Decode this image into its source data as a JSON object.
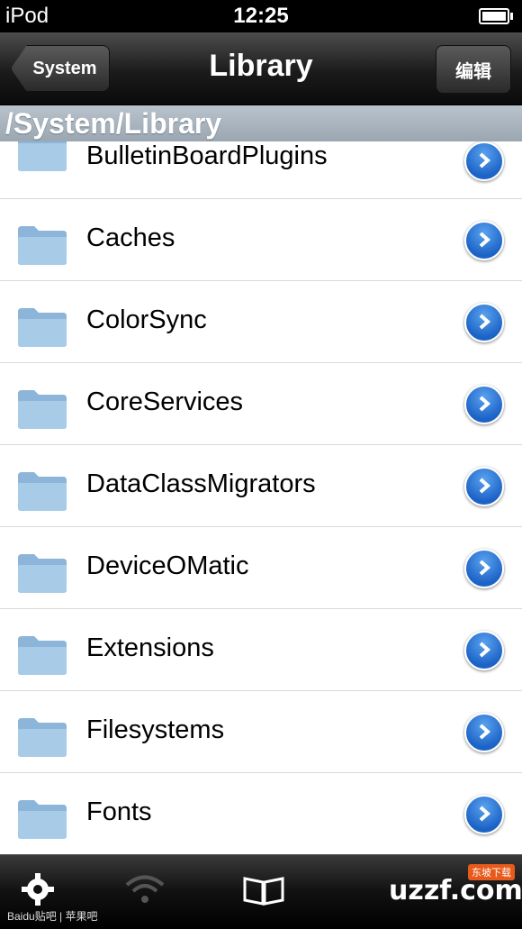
{
  "status_bar": {
    "carrier": "iPod",
    "time": "12:25"
  },
  "nav": {
    "back_label": "System",
    "title": "Library",
    "edit_label": "编辑"
  },
  "path": "/System/Library",
  "items": [
    {
      "name": "BulletinBoardPlugins"
    },
    {
      "name": "Caches"
    },
    {
      "name": "ColorSync"
    },
    {
      "name": "CoreServices"
    },
    {
      "name": "DataClassMigrators"
    },
    {
      "name": "DeviceOMatic"
    },
    {
      "name": "Extensions"
    },
    {
      "name": "Filesystems"
    },
    {
      "name": "Fonts"
    }
  ],
  "tabbar": {
    "icons": [
      "gear-icon",
      "wifi-icon",
      "book-icon"
    ],
    "watermark": "Baidu贴吧 | 苹果吧",
    "logo_text": "uzzf.com",
    "logo_badge": "东坡下载"
  },
  "colors": {
    "accent": "#1c63c7",
    "header": "#9aa6b1"
  }
}
